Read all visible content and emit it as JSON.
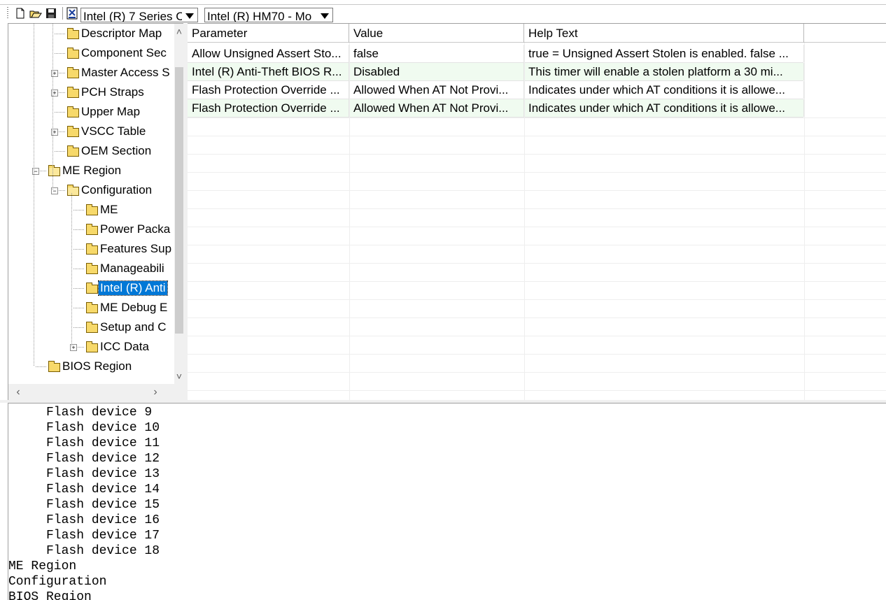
{
  "toolbar": {
    "buttons": [
      "new-file-icon",
      "open-folder-icon",
      "save-icon",
      "build-image-icon"
    ],
    "chipset_select": "Intel (R) 7 Series C",
    "sku_select": "Intel (R) HM70 - Mo"
  },
  "tree": {
    "nodes": [
      {
        "label": "Descriptor Map",
        "level": 2,
        "expander": "",
        "open": false
      },
      {
        "label": "Component Sec",
        "level": 2,
        "expander": "",
        "open": false
      },
      {
        "label": "Master Access S",
        "level": 2,
        "expander": "+",
        "open": false
      },
      {
        "label": "PCH Straps",
        "level": 2,
        "expander": "+",
        "open": false
      },
      {
        "label": "Upper Map",
        "level": 2,
        "expander": "",
        "open": false
      },
      {
        "label": "VSCC Table",
        "level": 2,
        "expander": "+",
        "open": false
      },
      {
        "label": "OEM Section",
        "level": 2,
        "expander": "",
        "open": false
      },
      {
        "label": "ME Region",
        "level": 1,
        "expander": "-",
        "open": true
      },
      {
        "label": "Configuration",
        "level": 2,
        "expander": "-",
        "open": true
      },
      {
        "label": "ME",
        "level": 3,
        "expander": "",
        "open": false
      },
      {
        "label": "Power Packa",
        "level": 3,
        "expander": "",
        "open": false
      },
      {
        "label": "Features Sup",
        "level": 3,
        "expander": "",
        "open": false
      },
      {
        "label": "Manageabili",
        "level": 3,
        "expander": "",
        "open": false
      },
      {
        "label": "Intel (R) Anti",
        "level": 3,
        "expander": "",
        "open": false,
        "selected": true
      },
      {
        "label": "ME Debug E",
        "level": 3,
        "expander": "",
        "open": false
      },
      {
        "label": "Setup and C",
        "level": 3,
        "expander": "",
        "open": false
      },
      {
        "label": "ICC Data",
        "level": 3,
        "expander": "+",
        "open": false
      },
      {
        "label": "BIOS Region",
        "level": 1,
        "expander": "",
        "open": false
      }
    ]
  },
  "grid": {
    "headers": [
      "Parameter",
      "Value",
      "Help Text"
    ],
    "rows": [
      [
        "Allow Unsigned Assert Sto...",
        "false",
        "true = Unsigned Assert Stolen is enabled. false ..."
      ],
      [
        "Intel (R) Anti-Theft BIOS R...",
        "Disabled",
        "This timer will enable a stolen platform a 30 mi..."
      ],
      [
        "Flash Protection Override ...",
        "Allowed When AT Not Provi...",
        "Indicates under which AT conditions it is allowe..."
      ],
      [
        "Flash Protection Override ...",
        "Allowed When AT Not Provi...",
        "Indicates under which AT conditions it is allowe..."
      ]
    ]
  },
  "log": {
    "lines": [
      "     Flash device 9",
      "     Flash device 10",
      "     Flash device 11",
      "     Flash device 12",
      "     Flash device 13",
      "     Flash device 14",
      "     Flash device 15",
      "     Flash device 16",
      "     Flash device 17",
      "     Flash device 18",
      "ME Region",
      "Configuration",
      "BIOS Region"
    ]
  }
}
